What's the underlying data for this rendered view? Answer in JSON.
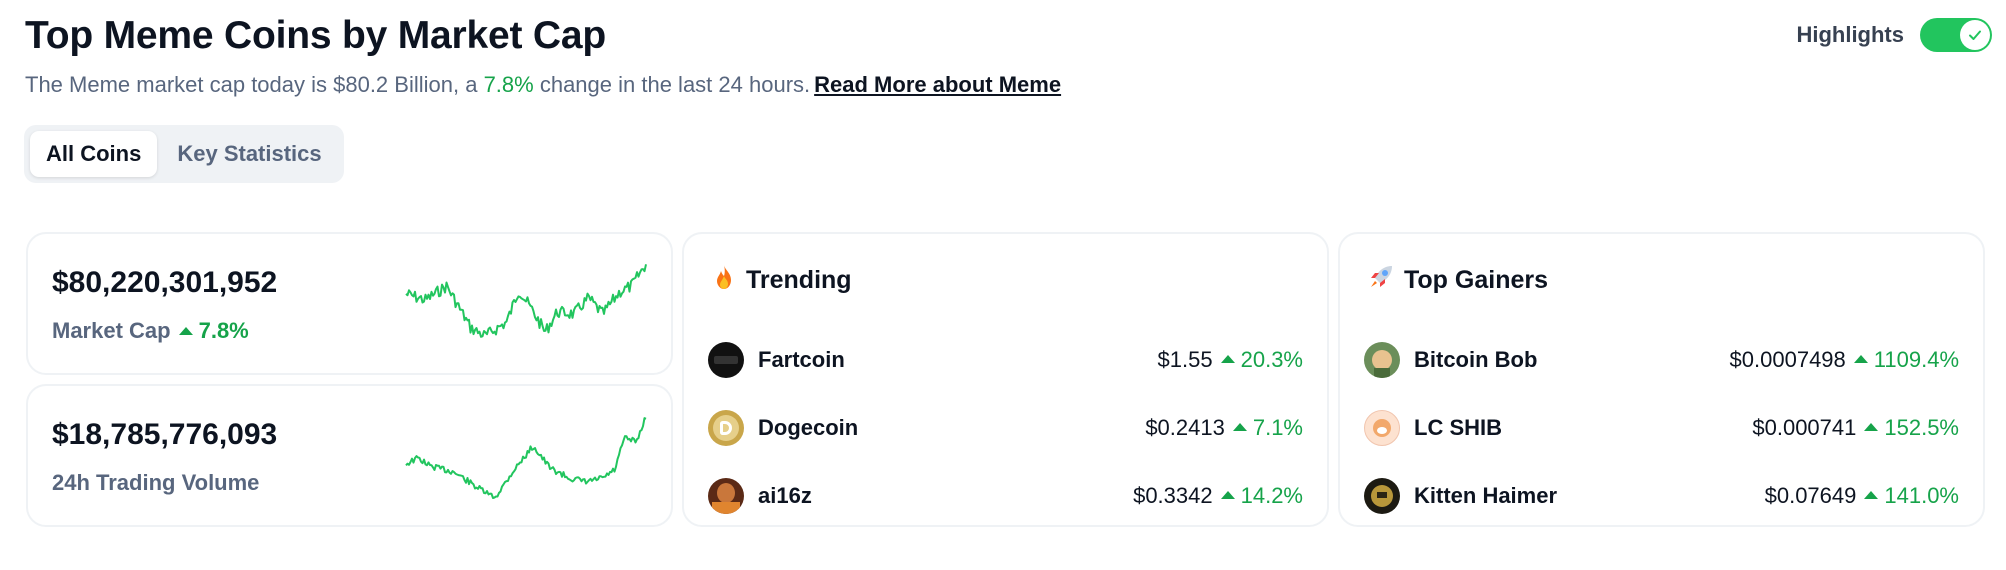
{
  "header": {
    "title": "Top Meme Coins by Market Cap",
    "subtitle_prefix": "The Meme market cap today is $80.2 Billion, a ",
    "subtitle_pct": "7.8%",
    "subtitle_suffix": " change in the last 24 hours.",
    "read_more": "Read More about Meme"
  },
  "highlights": {
    "label": "Highlights",
    "enabled": true
  },
  "tabs": [
    {
      "label": "All Coins",
      "active": true
    },
    {
      "label": "Key Statistics",
      "active": false
    }
  ],
  "stats": [
    {
      "value": "$80,220,301,952",
      "label": "Market Cap",
      "change": "7.8%"
    },
    {
      "value": "$18,785,776,093",
      "label": "24h Trading Volume",
      "change": ""
    }
  ],
  "trending": {
    "title": "Trending",
    "icon": "fire-icon",
    "items": [
      {
        "name": "Fartcoin",
        "price": "$1.55",
        "change": "20.3%"
      },
      {
        "name": "Dogecoin",
        "price": "$0.2413",
        "change": "7.1%"
      },
      {
        "name": "ai16z",
        "price": "$0.3342",
        "change": "14.2%"
      }
    ]
  },
  "gainers": {
    "title": "Top Gainers",
    "icon": "rocket-icon",
    "items": [
      {
        "name": "Bitcoin Bob",
        "price": "$0.0007498",
        "change": "1109.4%"
      },
      {
        "name": "LC SHIB",
        "price": "$0.000741",
        "change": "152.5%"
      },
      {
        "name": "Kitten Haimer",
        "price": "$0.07649",
        "change": "141.0%"
      }
    ]
  },
  "colors": {
    "positive": "#16a34a",
    "sparkline": "#22c55e",
    "toggle": "#22c55e"
  }
}
